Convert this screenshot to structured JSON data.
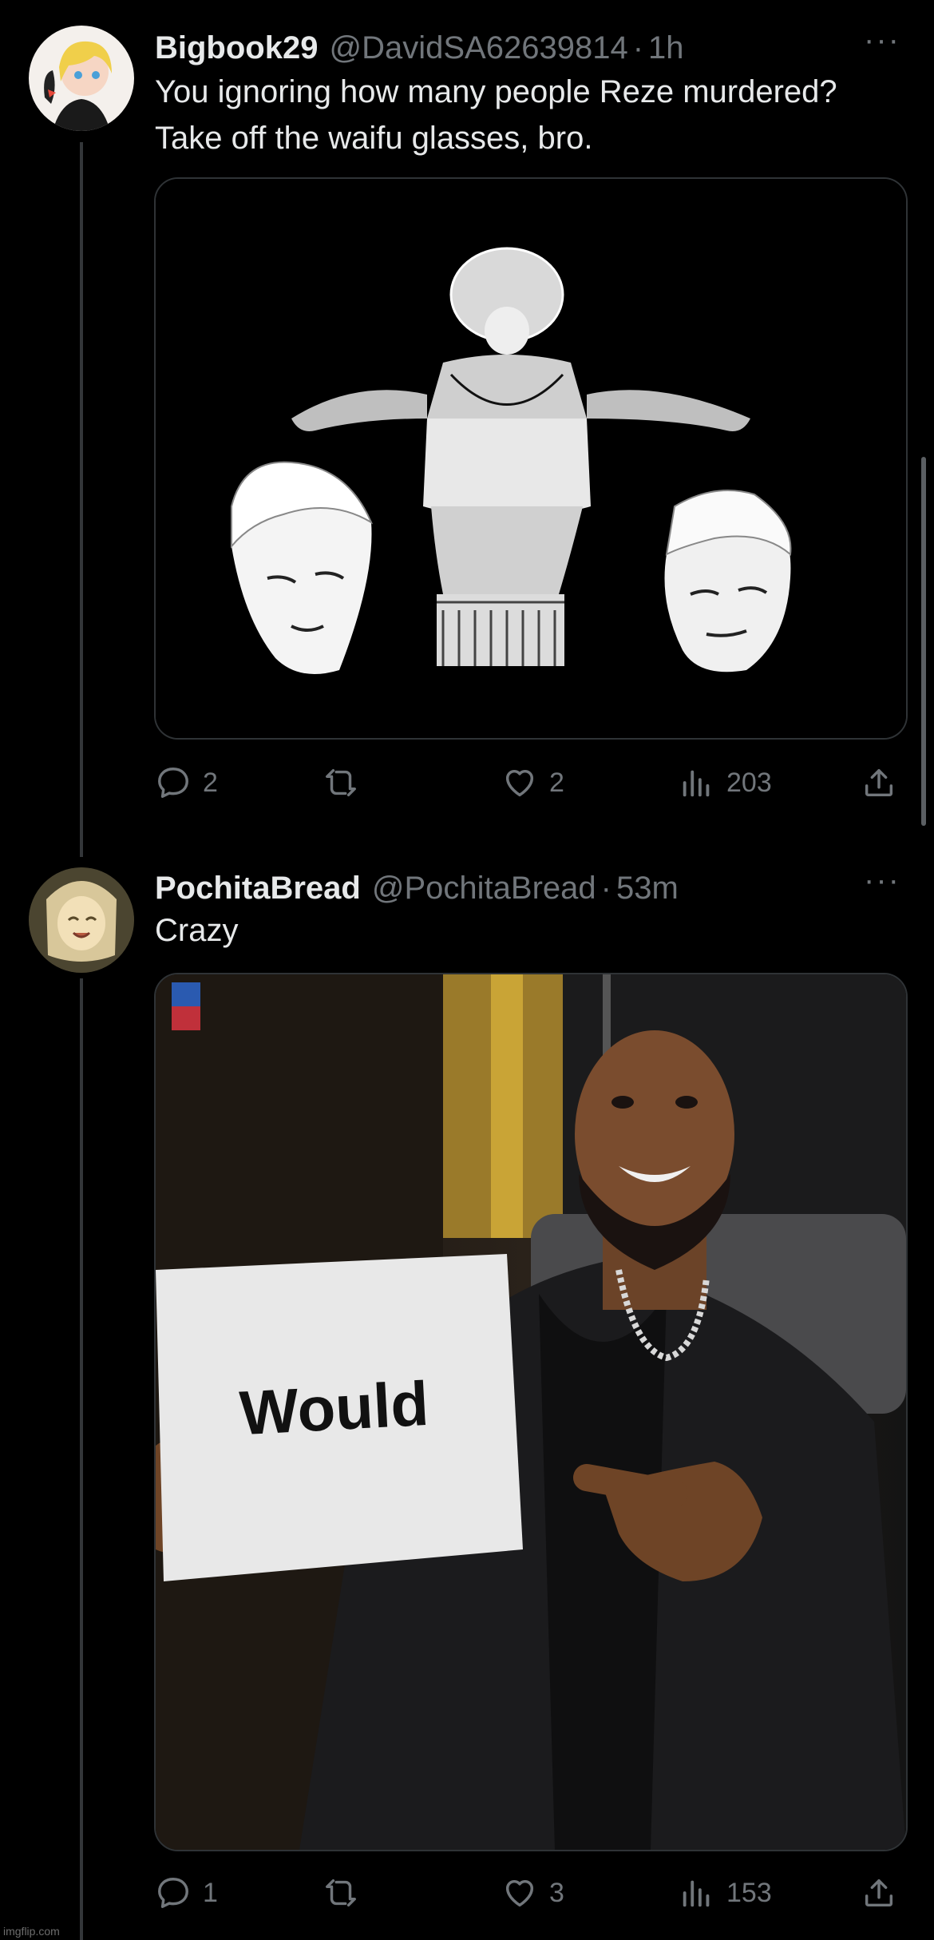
{
  "tweets": [
    {
      "name": "Bigbook29",
      "handle": "@DavidSA62639814",
      "time": "1h",
      "text": "You ignoring how many people Reze murdered? Take off the waifu glasses, bro.",
      "media_description_icon": "manga-panel-image",
      "stats": {
        "replies": "2",
        "retweets": "",
        "likes": "2",
        "views": "203"
      }
    },
    {
      "name": "PochitaBread",
      "handle": "@PochitaBread",
      "time": "53m",
      "text": "Crazy",
      "sign_text": "Would",
      "media_description_icon": "photo-image",
      "stats": {
        "replies": "1",
        "retweets": "",
        "likes": "3",
        "views": "153"
      }
    }
  ],
  "ui": {
    "separator": "·",
    "more": "···"
  },
  "watermark": "imgflip.com",
  "colors": {
    "background": "#000000",
    "text_primary": "#e7e9ea",
    "text_secondary": "#71767b",
    "border": "#2f3336"
  }
}
